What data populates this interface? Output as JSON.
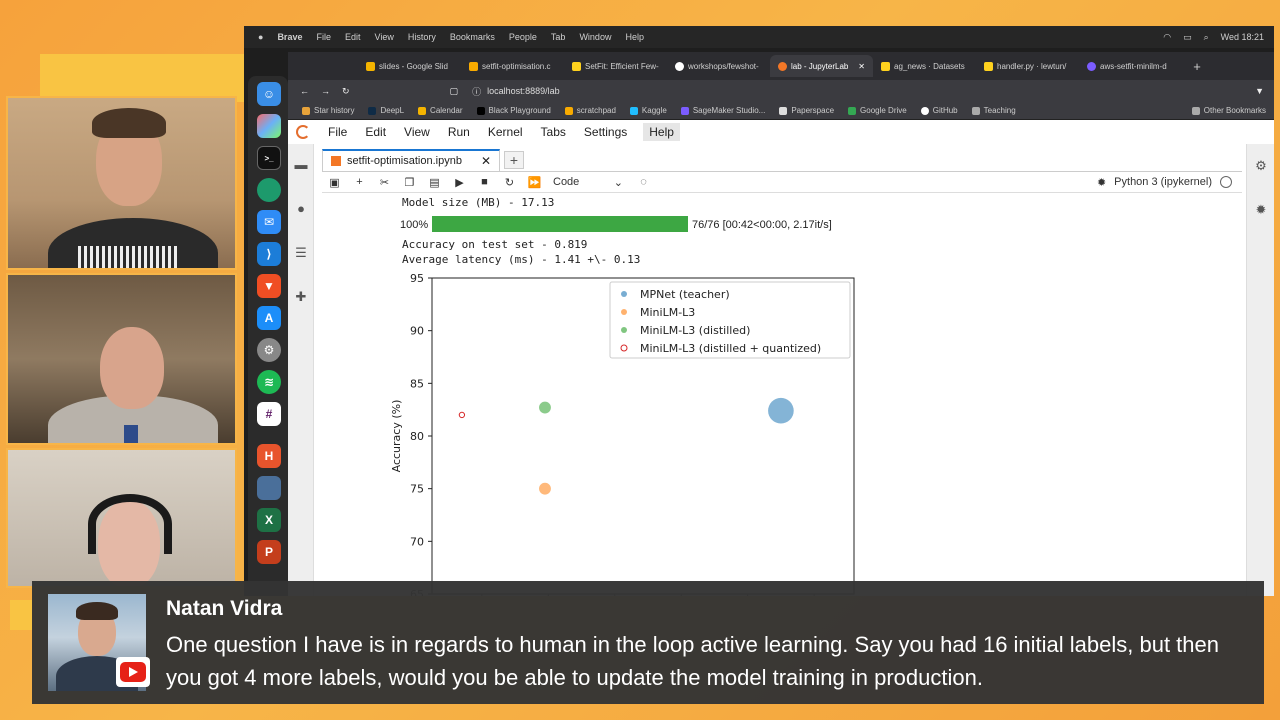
{
  "mac_menubar": {
    "app": "Brave",
    "items": [
      "File",
      "Edit",
      "View",
      "History",
      "Bookmarks",
      "People",
      "Tab",
      "Window",
      "Help"
    ],
    "clock": "Wed 18:21"
  },
  "browser": {
    "tabs": [
      {
        "label": "slides - Google Slid",
        "icon_color": "#f4b400"
      },
      {
        "label": "setfit-optimisation.c",
        "icon_color": "#f9ab00"
      },
      {
        "label": "SetFit: Efficient Few-",
        "icon_color": "#ffd21e"
      },
      {
        "label": "workshops/fewshot-",
        "icon_color": "#ffffff"
      },
      {
        "label": "lab - JupyterLab",
        "icon_color": "#f37726",
        "active": true
      },
      {
        "label": "ag_news · Datasets",
        "icon_color": "#ffd21e"
      },
      {
        "label": "handler.py · lewtun/",
        "icon_color": "#ffd21e"
      },
      {
        "label": "aws-setfit-minilm-d",
        "icon_color": "#7b5cff"
      }
    ],
    "address": "localhost:8889/lab",
    "bookmarks": [
      "Star history",
      "DeepL",
      "Calendar",
      "Black Playground",
      "scratchpad",
      "Kaggle",
      "SageMaker Studio...",
      "Paperspace",
      "Google Drive",
      "GitHub",
      "Teaching"
    ],
    "other_bookmarks": "Other Bookmarks"
  },
  "jupyter": {
    "menu": [
      "File",
      "Edit",
      "View",
      "Run",
      "Kernel",
      "Tabs",
      "Settings",
      "Help"
    ],
    "notebook_tab": "setfit-optimisation.ipynb",
    "cell_type": "Code",
    "kernel": "Python 3 (ipykernel)",
    "output": {
      "model_size": "Model size (MB) - 17.13",
      "progress_pct_label": "100%",
      "progress_value": 1.0,
      "progress_text": "76/76 [00:42<00:00, 2.17it/s]",
      "accuracy": "Accuracy on test set - 0.819",
      "latency": "Average latency (ms) - 1.41 +\\- 0.13"
    }
  },
  "chart_data": {
    "type": "scatter",
    "xlabel": "",
    "ylabel": "Accuracy (%)",
    "xlim": [
      0.5,
      13.2
    ],
    "ylim": [
      65,
      95
    ],
    "xticks": [
      2,
      4,
      6,
      8,
      10,
      12
    ],
    "yticks": [
      65,
      70,
      75,
      80,
      85,
      90,
      95
    ],
    "legend_position": "top-right",
    "series": [
      {
        "name": "MPNet (teacher)",
        "color": "#1f77b4",
        "style": "filled",
        "x": 11.0,
        "y": 82.4,
        "size": 420
      },
      {
        "name": "MiniLM-L3",
        "color": "#ff7f0e",
        "style": "filled",
        "x": 3.9,
        "y": 75.0,
        "size": 90
      },
      {
        "name": "MiniLM-L3 (distilled)",
        "color": "#2ca02c",
        "style": "filled",
        "x": 3.9,
        "y": 82.7,
        "size": 90
      },
      {
        "name": "MiniLM-L3 (distilled + quantized)",
        "color": "#d62728",
        "style": "hollow",
        "x": 1.4,
        "y": 82.0,
        "size": 18
      }
    ]
  },
  "comment": {
    "author": "Natan Vidra",
    "message": "One question I have is in regards to human in the loop active learning. Say you had 16 initial labels, but then you got 4 more labels, would you be able to update the model training in production."
  }
}
